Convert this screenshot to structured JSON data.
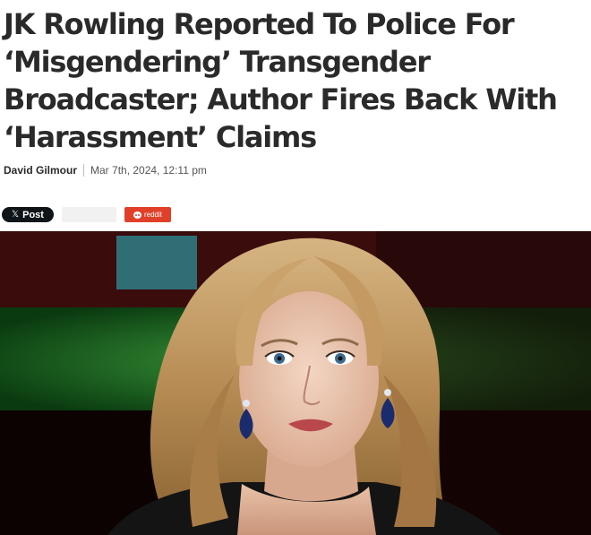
{
  "article": {
    "headline_lines": [
      "JK Rowling Reported To Police For",
      "‘Misgendering’ Transgender",
      "Broadcaster; Author Fires Back With",
      "‘Harassment’ Claims"
    ],
    "author": "David Gilmour",
    "date": "Mar 7th, 2024, 12:11 pm"
  },
  "share": {
    "x_label": "Post",
    "x_icon_glyph": "𝕏",
    "reddit_label": "reddit",
    "reddit_color": "#e0402a"
  },
  "photo": {
    "subject": "portrait-photo"
  }
}
